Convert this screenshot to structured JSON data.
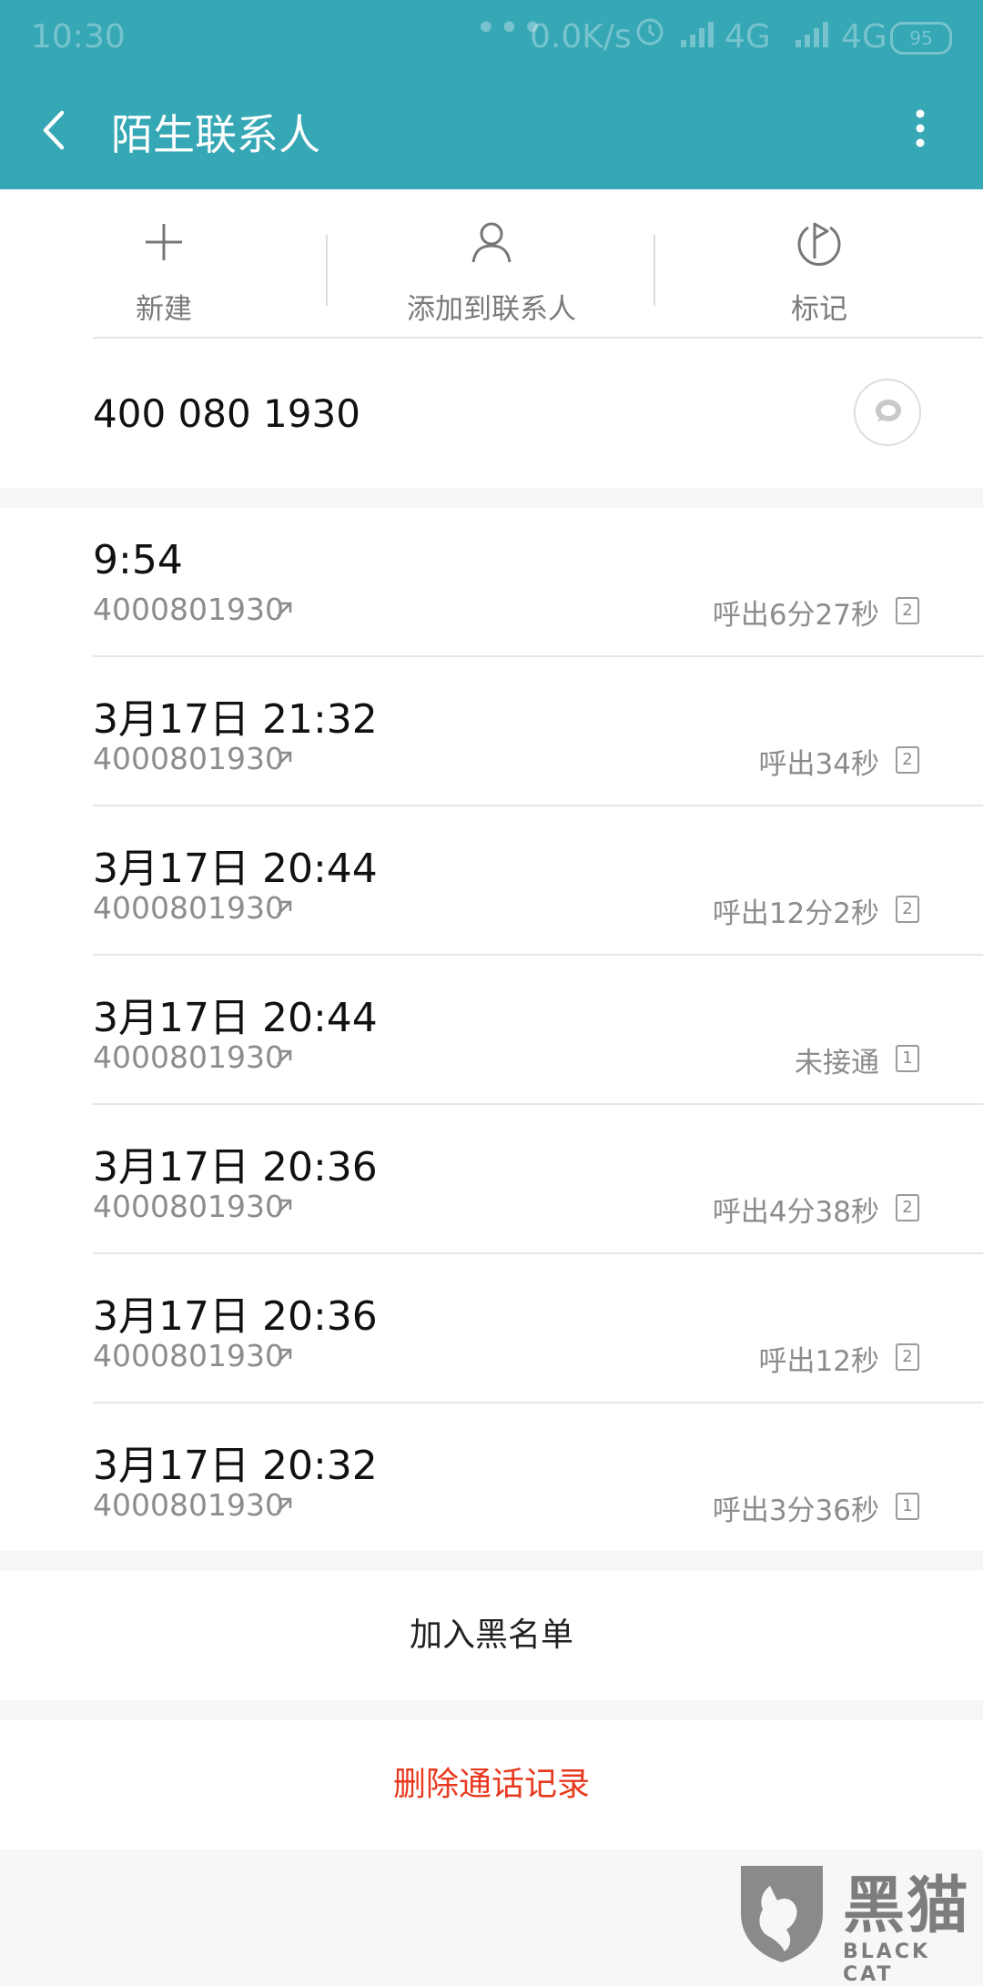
{
  "status_bar": {
    "time": "10:30",
    "dots": "•••",
    "speed": "0.0K/s",
    "network_1": "4G",
    "network_2": "4G",
    "battery": "95"
  },
  "header": {
    "title": "陌生联系人"
  },
  "actions": {
    "new_label": "新建",
    "add_contact_label": "添加到联系人",
    "mark_label": "标记"
  },
  "contact": {
    "phone": "400 080 1930"
  },
  "calls": [
    {
      "time": "9:54",
      "number": "4000801930",
      "status": "呼出6分27秒",
      "sim": "2"
    },
    {
      "time": "3月17日 21:32",
      "number": "4000801930",
      "status": "呼出34秒",
      "sim": "2"
    },
    {
      "time": "3月17日 20:44",
      "number": "4000801930",
      "status": "呼出12分2秒",
      "sim": "2"
    },
    {
      "time": "3月17日 20:44",
      "number": "4000801930",
      "status": "未接通",
      "sim": "1"
    },
    {
      "time": "3月17日 20:36",
      "number": "4000801930",
      "status": "呼出4分38秒",
      "sim": "2"
    },
    {
      "time": "3月17日 20:36",
      "number": "4000801930",
      "status": "呼出12秒",
      "sim": "2"
    },
    {
      "time": "3月17日 20:32",
      "number": "4000801930",
      "status": "呼出3分36秒",
      "sim": "1"
    }
  ],
  "buttons": {
    "block_label": "加入黑名单",
    "delete_label": "删除通话记录"
  },
  "watermark": {
    "brand": "黑猫",
    "sub": "BLACK CAT"
  },
  "colors": {
    "header_bg": "#36a7b5",
    "delete_red": "#e8391f"
  }
}
